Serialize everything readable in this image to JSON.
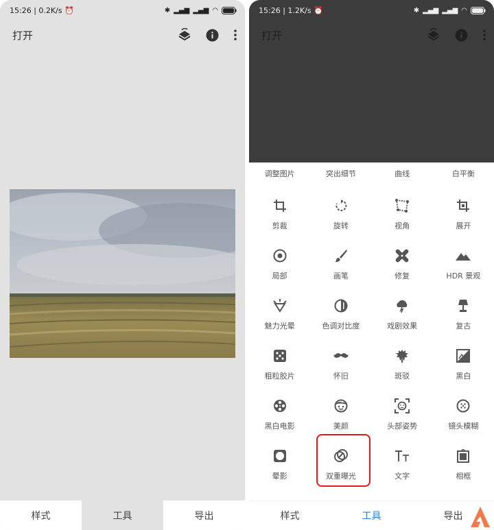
{
  "left": {
    "status": {
      "time": "15:26",
      "speed": "0.2K/s"
    },
    "appbar": {
      "title": "打开"
    },
    "tabs": [
      "样式",
      "工具",
      "导出"
    ]
  },
  "right": {
    "status": {
      "time": "15:26",
      "speed": "1.2K/s"
    },
    "appbar": {
      "title": "打开"
    },
    "top_row": [
      "调整图片",
      "突出细节",
      "曲线",
      "白平衡"
    ],
    "tools": [
      {
        "label": "剪裁",
        "icon": "crop-icon"
      },
      {
        "label": "旋转",
        "icon": "rotate-icon"
      },
      {
        "label": "视角",
        "icon": "perspective-icon"
      },
      {
        "label": "展开",
        "icon": "expand-icon"
      },
      {
        "label": "局部",
        "icon": "selective-icon"
      },
      {
        "label": "画笔",
        "icon": "brush-icon"
      },
      {
        "label": "修复",
        "icon": "healing-icon"
      },
      {
        "label": "HDR 景观",
        "icon": "hdr-mountain-icon"
      },
      {
        "label": "魅力光晕",
        "icon": "glamour-glow-icon"
      },
      {
        "label": "色调对比度",
        "icon": "tonal-contrast-icon"
      },
      {
        "label": "戏剧效果",
        "icon": "drama-cloud-icon"
      },
      {
        "label": "复古",
        "icon": "vintage-lamp-icon"
      },
      {
        "label": "粗粒胶片",
        "icon": "grainy-film-icon"
      },
      {
        "label": "怀旧",
        "icon": "retrolux-mustache-icon"
      },
      {
        "label": "斑驳",
        "icon": "grunge-icon"
      },
      {
        "label": "黑白",
        "icon": "black-white-icon"
      },
      {
        "label": "黑白电影",
        "icon": "noir-film-reel-icon"
      },
      {
        "label": "美颜",
        "icon": "face-icon"
      },
      {
        "label": "头部姿势",
        "icon": "head-pose-icon"
      },
      {
        "label": "镜头模糊",
        "icon": "lens-blur-icon"
      },
      {
        "label": "晕影",
        "icon": "vignette-icon"
      },
      {
        "label": "双重曝光",
        "icon": "double-exposure-icon"
      },
      {
        "label": "文字",
        "icon": "text-icon"
      },
      {
        "label": "相框",
        "icon": "frame-icon"
      }
    ],
    "tabs": [
      "样式",
      "工具",
      "导出"
    ]
  },
  "colors": {
    "accent": "#2e7fd9",
    "highlight": "#e31b1b",
    "dark_bg": "#3c3c3c",
    "light_bg": "#e2e2e2"
  }
}
